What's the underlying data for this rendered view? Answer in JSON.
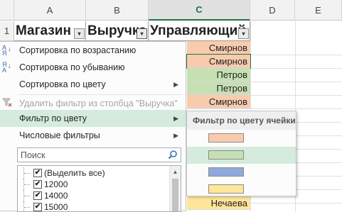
{
  "columns": {
    "a": "A",
    "b": "B",
    "c": "C",
    "d": "D",
    "e": "E"
  },
  "rows": [
    "1"
  ],
  "header_row": {
    "col_a": "Магазин",
    "col_b": "Выручка",
    "col_c": "Управляющий"
  },
  "filter_button_glyph": "▾",
  "column_c_values": [
    {
      "text": "Смирнов",
      "color": "#f8cbad"
    },
    {
      "text": "Смирнов",
      "color": "#f8cbad"
    },
    {
      "text": "Петров",
      "color": "#c6e0b4"
    },
    {
      "text": "Петров",
      "color": "#c6e0b4"
    },
    {
      "text": "Смирнов",
      "color": "#f8cbad"
    },
    {
      "text": "Нечаева",
      "color": "#ffe699"
    }
  ],
  "menu": {
    "sort_asc": "Сортировка по возрастанию",
    "sort_desc": "Сортировка по убыванию",
    "sort_by_color": "Сортировка по цвету",
    "clear_filter": "Удалить фильтр из столбца \"Выручка\"",
    "filter_by_color": "Фильтр по цвету",
    "number_filters": "Числовые фильтры",
    "sort_asc_icon_text": "А\nЯ",
    "sort_desc_icon_text": "Я\nА"
  },
  "search": {
    "placeholder": "Поиск",
    "icon": "search-icon"
  },
  "list": {
    "items": [
      {
        "label": "(Выделить все)",
        "checked": true
      },
      {
        "label": "12000",
        "checked": true
      },
      {
        "label": "14000",
        "checked": true
      },
      {
        "label": "15000",
        "checked": true
      }
    ],
    "check_glyph": "✔"
  },
  "color_submenu": {
    "title": "Фильтр по цвету ячейки",
    "swatches": [
      "#f8cbad",
      "#c6e0b4",
      "#8ea9db",
      "#ffe699"
    ],
    "highlighted_index": 1
  },
  "colors": {
    "accent_green": "#217346",
    "menu_highlight": "#d4ebdd"
  }
}
